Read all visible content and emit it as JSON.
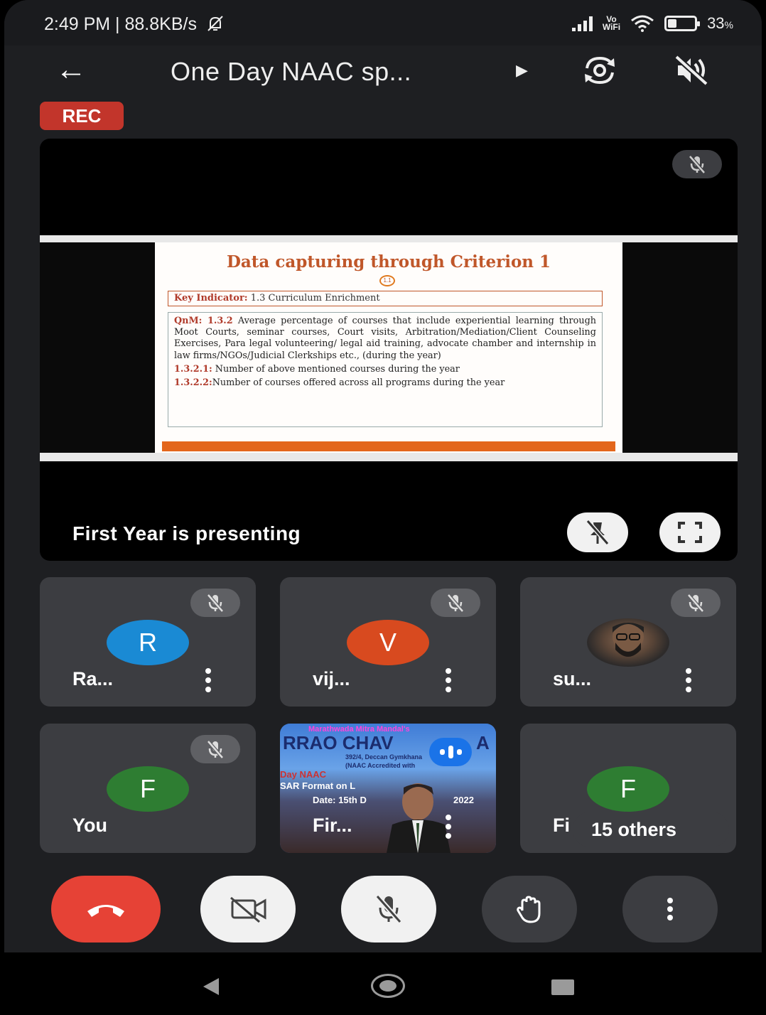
{
  "status_bar": {
    "time_speed": "2:49 PM | 88.8KB/s",
    "wifi_label": "Vo\nWiFi",
    "battery": "33",
    "battery_unit": "%",
    "battery_level": 0.33
  },
  "app_bar": {
    "title": "One Day NAAC sp...",
    "back_icon": "arrow-left-icon",
    "rotate_icon": "camera-switch-icon",
    "speaker_icon": "speaker-off-icon"
  },
  "rec_badge": "REC",
  "presentation": {
    "slide_title": "Data capturing through Criterion 1",
    "slide_number": "1.1",
    "key_indicator_label": "Key Indicator:",
    "key_indicator_text": "1.3 Curriculum Enrichment",
    "qnm_label": "QnM: 1.3.2",
    "qnm_text": "Average percentage of courses that include experiential learning through Moot Courts, seminar courses, Court visits, Arbitration/Mediation/Client Counseling Exercises, Para legal volunteering/ legal aid training, advocate chamber and internship in law firms/NGOs/Judicial Clerkships etc., (during the year)",
    "item1_label": "1.3.2.1:",
    "item1_text": "Number of above mentioned courses during the year",
    "item2_label": "1.3.2.2:",
    "item2_text": "Number of courses offered across all programs during the year",
    "presenting_text": "First Year is presenting"
  },
  "participants": [
    {
      "initial": "R",
      "name": "Ra...",
      "color": "#1a8ad4"
    },
    {
      "initial": "V",
      "name": "vij...",
      "color": "#d84a1f"
    },
    {
      "initial": "",
      "name": "su..."
    },
    {
      "initial": "F",
      "name": "You",
      "color": "#2e7d32"
    },
    {
      "initial": "",
      "name": "Fir..."
    },
    {
      "initial": "F",
      "name": "Fi",
      "color": "#2e7d32"
    }
  ],
  "video_banner": {
    "line1": "Marathwada Mitra Mandal's",
    "line2": "RRAO CHAV",
    "line2b": "A",
    "line3": "392/4, Deccan Gymkhana",
    "line4": "(NAAC Accredited with",
    "line5": "Day NAAC",
    "line6": "SAR Format on L",
    "line7": "Date: 15th D",
    "line7b": "2022"
  },
  "others_label": "15 others",
  "controls": {
    "end": "phone-hangup-icon",
    "camera": "camera-off-icon",
    "mic": "mic-off-icon",
    "hand": "raise-hand-icon",
    "more": "more-vertical-icon"
  }
}
